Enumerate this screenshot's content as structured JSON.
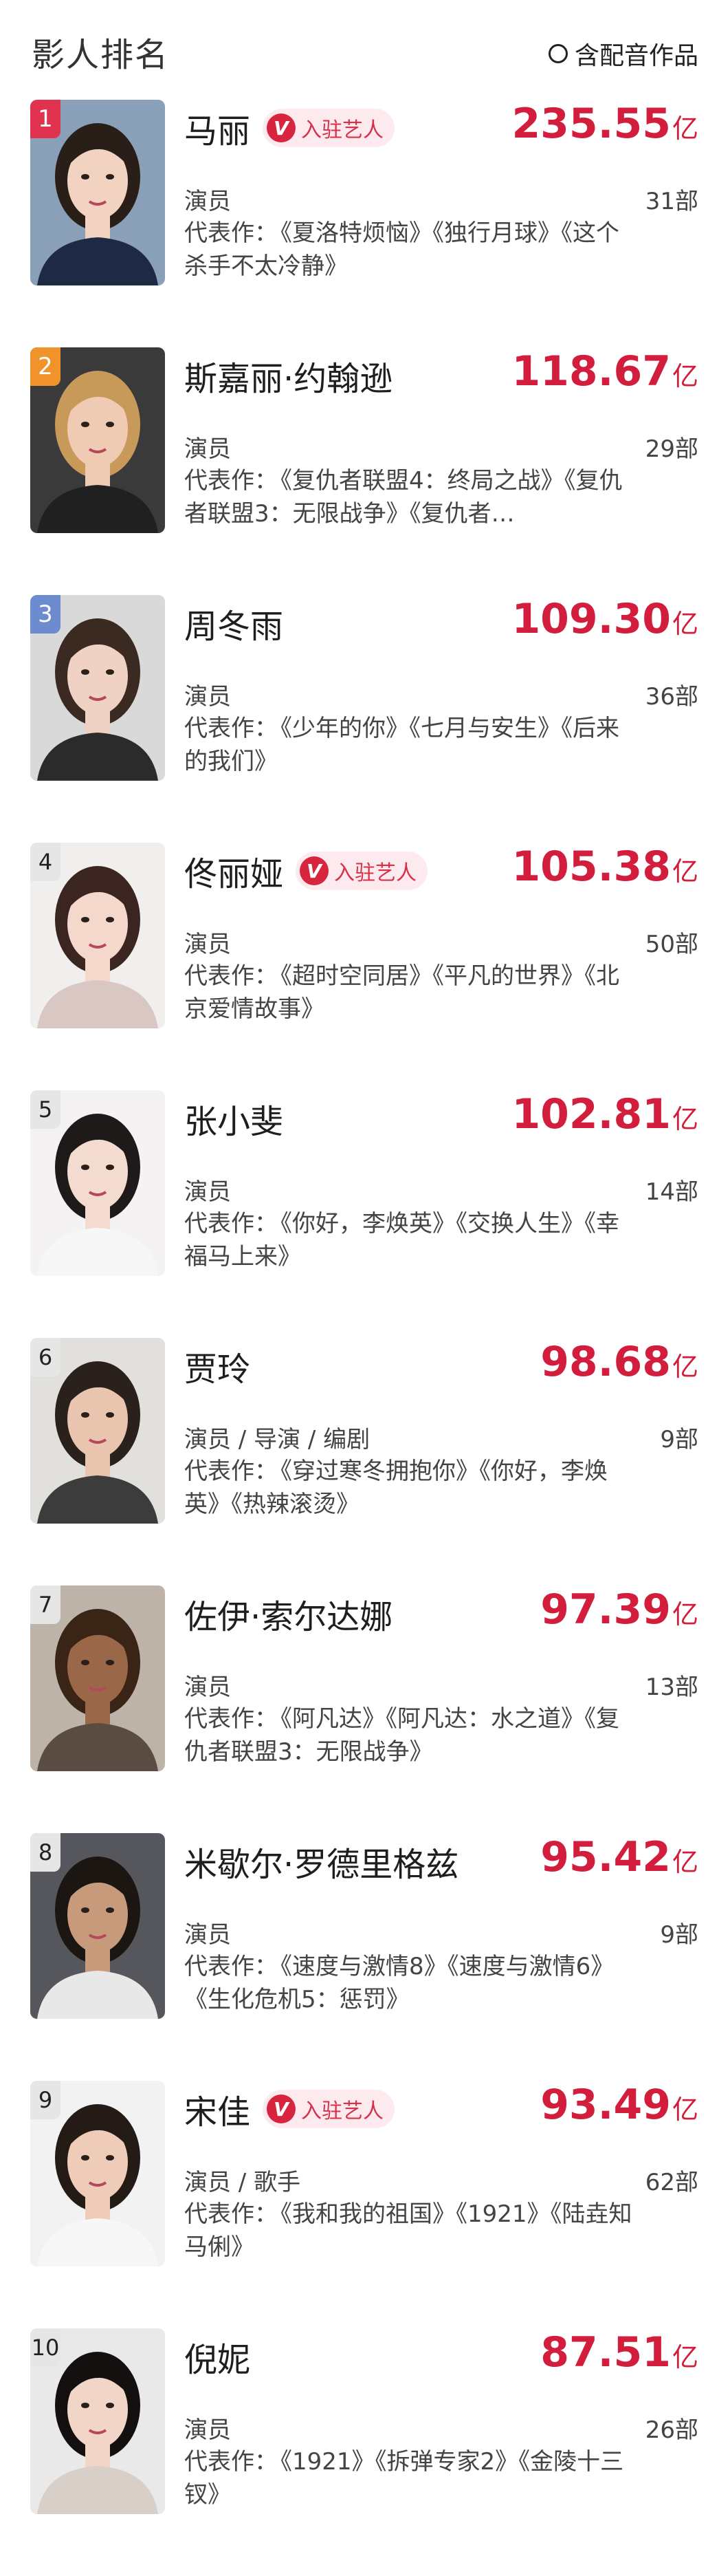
{
  "header": {
    "title": "影人排名",
    "filter_label": "含配音作品"
  },
  "colors": {
    "accent": "#d21e3c",
    "rank1": "#e0334f",
    "rank2": "#f0932b",
    "rank3": "#6d8ccf",
    "rank_other": "#e6e6e6"
  },
  "badge_label": "入驻艺人",
  "works_label": "代表作：",
  "actors": [
    {
      "rank": "1",
      "name": "马丽",
      "verified": true,
      "box": "235.55",
      "unit": "亿",
      "roles": "演员",
      "count": "31部",
      "works": "《夏洛特烦恼》《独行月球》《这个杀手不太冷静》",
      "bg": "#8aa0b8",
      "hair": "#2a1e18",
      "skin": "#f2d3c2",
      "cloth": "#1e2a44"
    },
    {
      "rank": "2",
      "name": "斯嘉丽·约翰逊",
      "verified": false,
      "box": "118.67",
      "unit": "亿",
      "roles": "演员",
      "count": "29部",
      "works": "《复仇者联盟4：终局之战》《复仇者联盟3：无限战争》《复仇者…",
      "bg": "#3a3a3a",
      "hair": "#c89a5a",
      "skin": "#efcbb4",
      "cloth": "#202020"
    },
    {
      "rank": "3",
      "name": "周冬雨",
      "verified": false,
      "box": "109.30",
      "unit": "亿",
      "roles": "演员",
      "count": "36部",
      "works": "《少年的你》《七月与安生》《后来的我们》",
      "bg": "#d9d9d9",
      "hair": "#3a2a22",
      "skin": "#f0d2c4",
      "cloth": "#2b2b2b"
    },
    {
      "rank": "4",
      "name": "佟丽娅",
      "verified": true,
      "box": "105.38",
      "unit": "亿",
      "roles": "演员",
      "count": "50部",
      "works": "《超时空同居》《平凡的世界》《北京爱情故事》",
      "bg": "#f1eeee",
      "hair": "#3b2520",
      "skin": "#f4d8cc",
      "cloth": "#d9c7c4"
    },
    {
      "rank": "5",
      "name": "张小斐",
      "verified": false,
      "box": "102.81",
      "unit": "亿",
      "roles": "演员",
      "count": "14部",
      "works": "《你好，李焕英》《交换人生》《幸福马上来》",
      "bg": "#f4f2f2",
      "hair": "#1f1a1a",
      "skin": "#f4dbd0",
      "cloth": "#f7f7f7"
    },
    {
      "rank": "6",
      "name": "贾玲",
      "verified": false,
      "box": "98.68",
      "unit": "亿",
      "roles": "演员 / 导演 / 编剧",
      "count": "9部",
      "works": "《穿过寒冬拥抱你》《你好，李焕英》《热辣滚烫》",
      "bg": "#e2e0dd",
      "hair": "#2a211d",
      "skin": "#e9c4ae",
      "cloth": "#3c3c3c"
    },
    {
      "rank": "7",
      "name": "佐伊·索尔达娜",
      "verified": false,
      "box": "97.39",
      "unit": "亿",
      "roles": "演员",
      "count": "13部",
      "works": "《阿凡达》《阿凡达：水之道》《复仇者联盟3：无限战争》",
      "bg": "#bdb3a9",
      "hair": "#3a2416",
      "skin": "#9a6848",
      "cloth": "#5b4c43"
    },
    {
      "rank": "8",
      "name": "米歇尔·罗德里格兹",
      "verified": false,
      "box": "95.42",
      "unit": "亿",
      "roles": "演员",
      "count": "9部",
      "works": "《速度与激情8》《速度与激情6》《生化危机5：惩罚》",
      "bg": "#55575c",
      "hair": "#1c1613",
      "skin": "#c89a7c",
      "cloth": "#e8e8e8"
    },
    {
      "rank": "9",
      "name": "宋佳",
      "verified": true,
      "box": "93.49",
      "unit": "亿",
      "roles": "演员 / 歌手",
      "count": "62部",
      "works": "《我和我的祖国》《1921》《陆垚知马俐》",
      "bg": "#f2f2f2",
      "hair": "#241b17",
      "skin": "#efccb8",
      "cloth": "#f7f7f7"
    },
    {
      "rank": "10",
      "name": "倪妮",
      "verified": false,
      "box": "87.51",
      "unit": "亿",
      "roles": "演员",
      "count": "26部",
      "works": "《1921》《拆弹专家2》《金陵十三钗》",
      "bg": "#e9e9e9",
      "hair": "#14100f",
      "skin": "#f1d5c6",
      "cloth": "#d8d0c8"
    }
  ]
}
